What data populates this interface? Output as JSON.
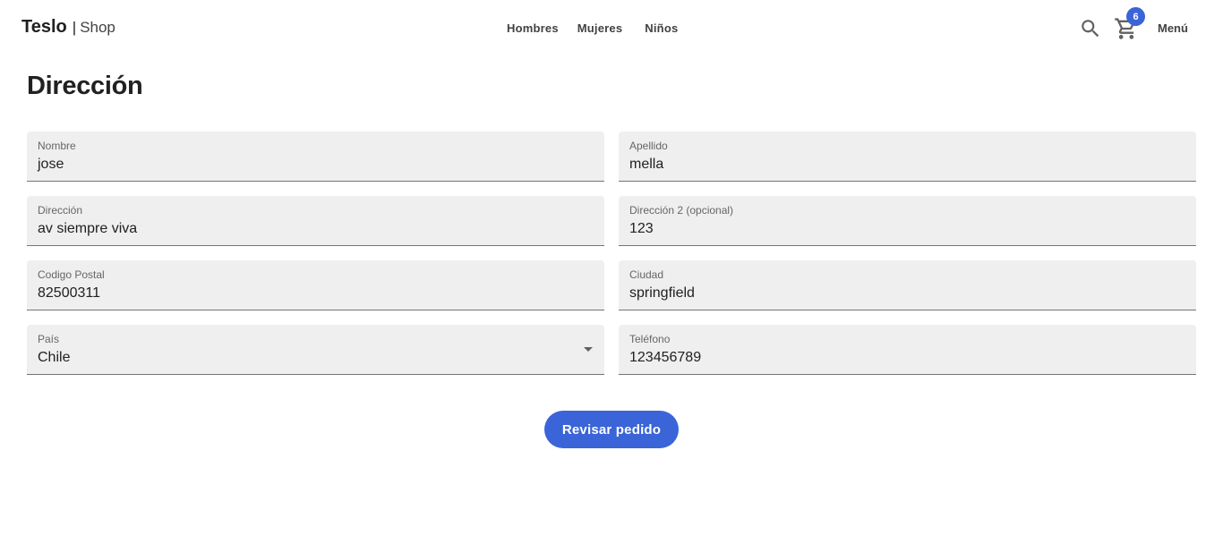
{
  "header": {
    "brand_name": "Teslo",
    "brand_separator": "|",
    "brand_shop": "Shop",
    "nav": [
      "Hombres",
      "Mujeres",
      "Niños"
    ],
    "search_icon": "search-icon",
    "cart_icon": "cart-icon",
    "cart_count": "6",
    "menu_label": "Menú"
  },
  "page": {
    "title": "Dirección"
  },
  "form": {
    "nombre": {
      "label": "Nombre",
      "value": "jose"
    },
    "apellido": {
      "label": "Apellido",
      "value": "mella"
    },
    "direccion": {
      "label": "Dirección",
      "value": "av siempre viva"
    },
    "direccion2": {
      "label": "Dirección 2 (opcional)",
      "value": "123"
    },
    "codigo_postal": {
      "label": "Codigo Postal",
      "value": "82500311"
    },
    "ciudad": {
      "label": "Ciudad",
      "value": "springfield"
    },
    "pais": {
      "label": "País",
      "value": "Chile"
    },
    "telefono": {
      "label": "Teléfono",
      "value": "123456789"
    },
    "submit_label": "Revisar pedido"
  },
  "colors": {
    "accent": "#3a64d8",
    "field_bg": "#efefef"
  }
}
